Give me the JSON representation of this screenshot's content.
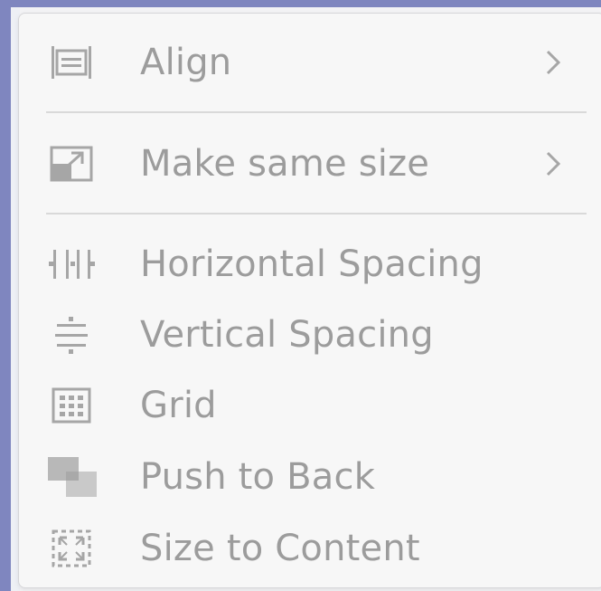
{
  "menu": {
    "items": [
      {
        "label": "Align",
        "icon": "align-icon",
        "submenu": true
      },
      {
        "label": "Make same size",
        "icon": "resize-icon",
        "submenu": true
      },
      {
        "label": "Horizontal Spacing",
        "icon": "horizontal-spacing-icon",
        "submenu": false
      },
      {
        "label": "Vertical Spacing",
        "icon": "vertical-spacing-icon",
        "submenu": false
      },
      {
        "label": "Grid",
        "icon": "grid-icon",
        "submenu": false
      },
      {
        "label": "Push to Back",
        "icon": "push-to-back-icon",
        "submenu": false
      },
      {
        "label": "Size to Content",
        "icon": "size-to-content-icon",
        "submenu": false
      }
    ]
  },
  "colors": {
    "text_disabled": "#9c9c9c",
    "icon_disabled": "#a6a6a6",
    "window_border": "#7f86bf",
    "menu_bg": "#f7f7f7"
  }
}
